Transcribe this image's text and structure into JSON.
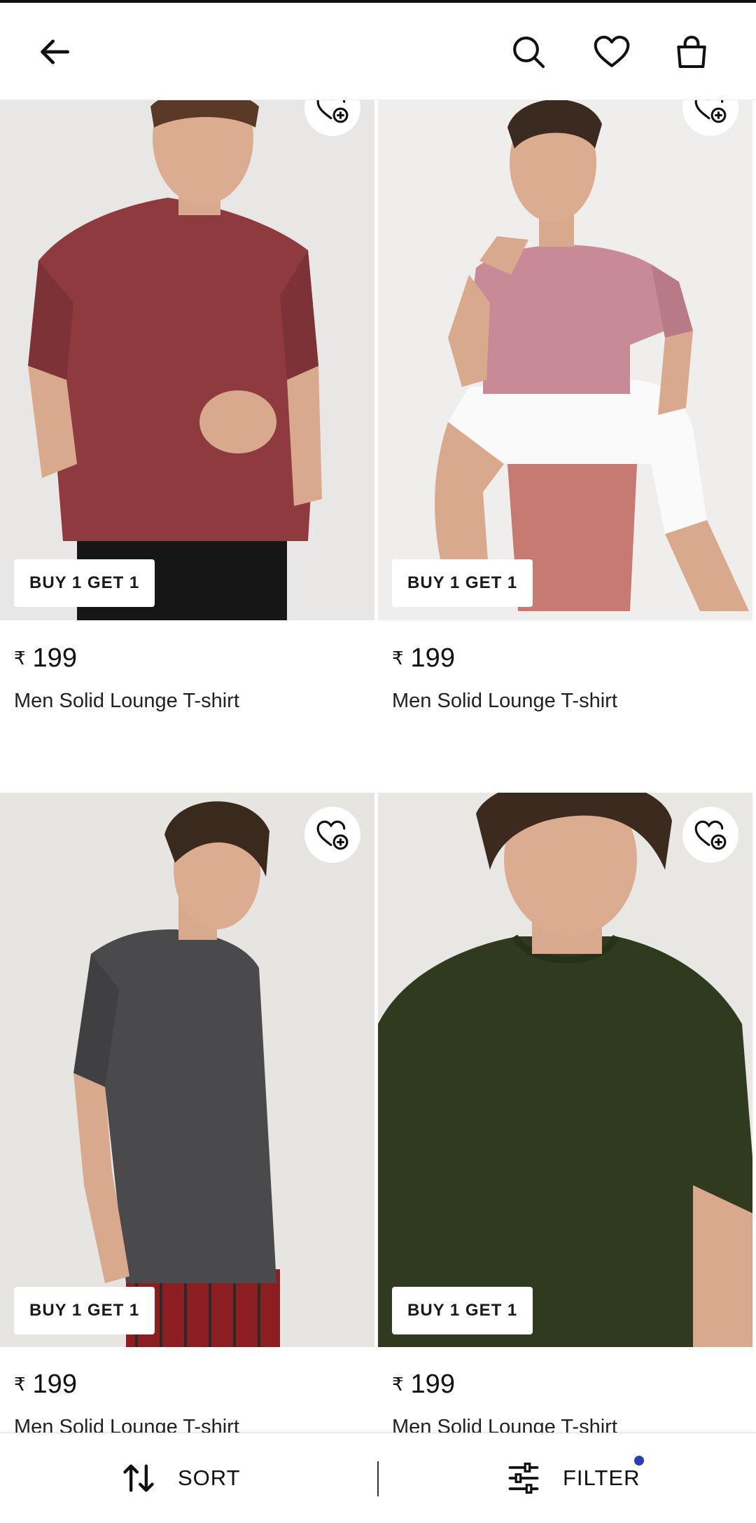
{
  "header": {
    "back_icon": "arrow-left-icon",
    "search_icon": "search-icon",
    "wishlist_icon": "heart-icon",
    "bag_icon": "shopping-bag-icon"
  },
  "products": [
    {
      "offer": "BUY 1 GET 1",
      "currency": "₹",
      "price": "199",
      "name": "Men Solid Lounge T-shirt",
      "color": "#8e3a3f",
      "bg": "#e9e7e5"
    },
    {
      "offer": "BUY 1 GET 1",
      "currency": "₹",
      "price": "199",
      "name": "Men Solid Lounge T-shirt",
      "color": "#c98a98",
      "bg": "#efeeed"
    },
    {
      "offer": "BUY 1 GET 1",
      "currency": "₹",
      "price": "199",
      "name": "Men Solid Lounge T-shirt",
      "color": "#4a4a4c",
      "bg": "#e7e5e2"
    },
    {
      "offer": "BUY 1 GET 1",
      "currency": "₹",
      "price": "199",
      "name": "Men Solid Lounge T-shirt",
      "color": "#2f3a1f",
      "bg": "#e8e7e4"
    }
  ],
  "bottom_bar": {
    "sort_label": "SORT",
    "filter_label": "FILTER",
    "sort_icon": "sort-arrows-icon",
    "filter_icon": "sliders-icon",
    "filter_active_color": "#2a3db5"
  }
}
